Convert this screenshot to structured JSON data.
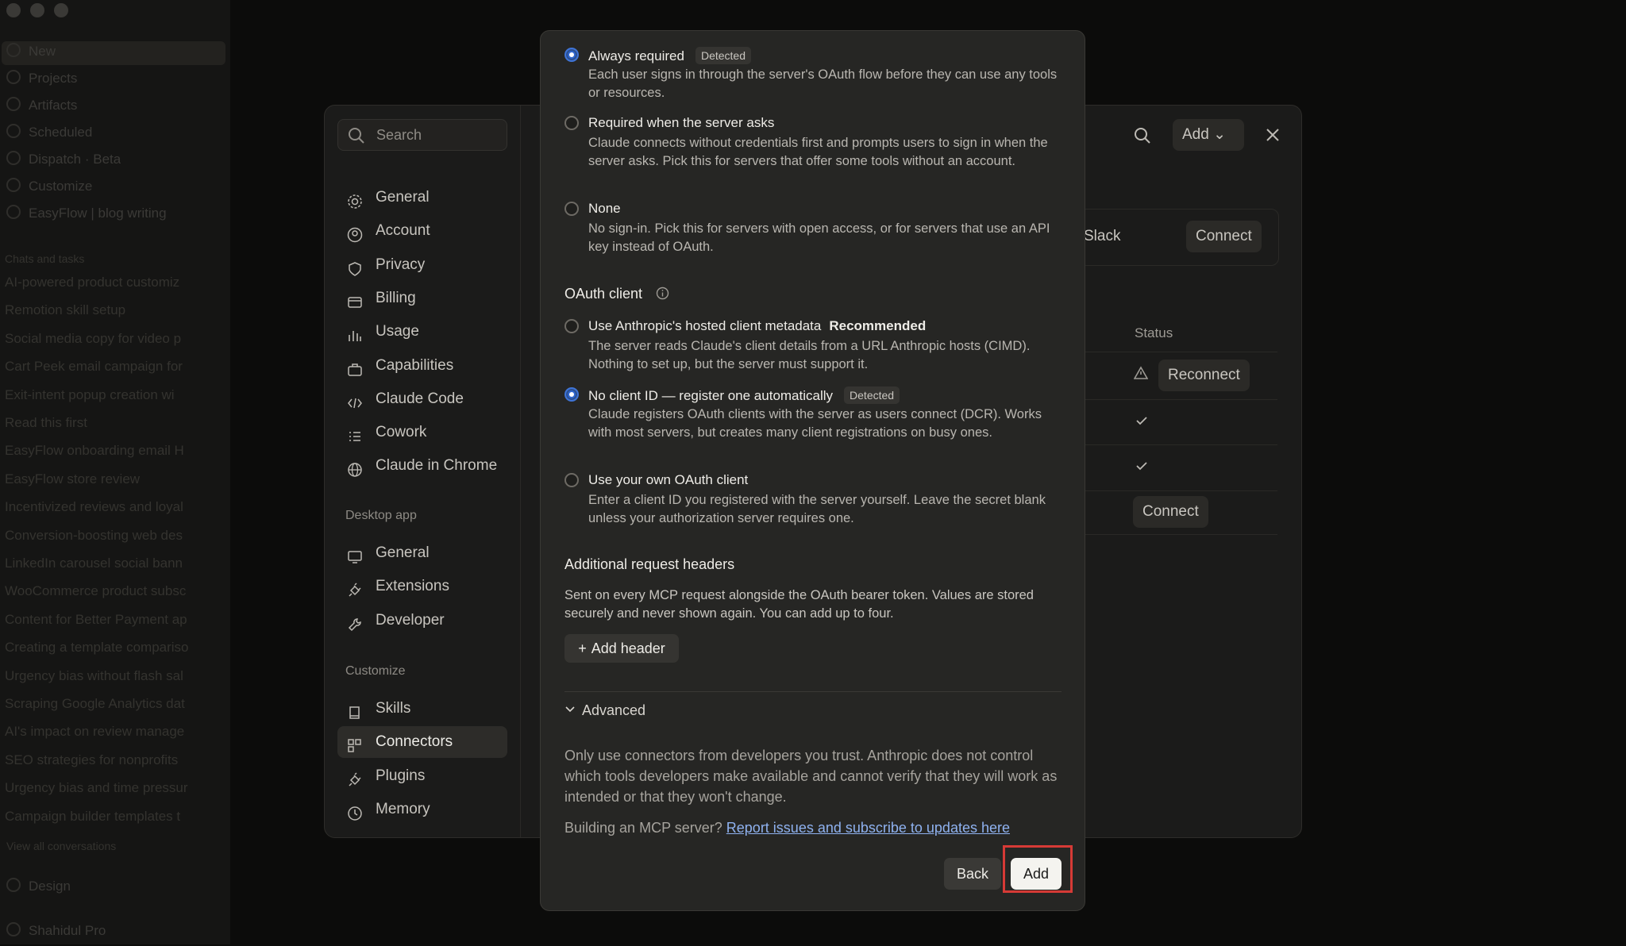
{
  "background_sidebar": {
    "rows": [
      "New",
      "Projects",
      "Artifacts",
      "Scheduled",
      "Dispatch · Beta",
      "Customize",
      "EasyFlow | blog writing"
    ],
    "section_label": "Chats and tasks",
    "chats": [
      "AI-powered product customiz",
      "Remotion skill setup",
      "Social media copy for video p",
      "Cart Peek email campaign for",
      "Exit-intent popup creation wi",
      "Read this first",
      "EasyFlow onboarding email H",
      "EasyFlow store review",
      "Incentivized reviews and loyal",
      "Conversion-boosting web des",
      "LinkedIn carousel social bann",
      "WooCommerce product subsc",
      "Content for Better Payment ap",
      "Creating a template compariso",
      "Urgency bias without flash sal",
      "Scraping Google Analytics dat",
      "AI's impact on review manage",
      "SEO strategies for nonprofits",
      "Urgency bias and time pressur",
      "Campaign builder templates t"
    ],
    "view_all": "View all conversations",
    "design": "Design",
    "user": "Shahidul",
    "plan": "Pro"
  },
  "settings": {
    "search_placeholder": "Search",
    "nav": [
      "General",
      "Account",
      "Privacy",
      "Billing",
      "Usage",
      "Capabilities",
      "Claude Code",
      "Cowork",
      "Claude in Chrome"
    ],
    "desktop_section": "Desktop app",
    "desktop_nav": [
      "General",
      "Extensions",
      "Developer"
    ],
    "customize_section": "Customize",
    "customize_nav": [
      "Skills",
      "Connectors",
      "Plugins",
      "Memory"
    ],
    "top_add": "Add",
    "slack_label": "Slack",
    "slack_connect": "Connect",
    "status_header": "Status",
    "reconnect": "Reconnect",
    "connect": "Connect"
  },
  "modal": {
    "auth_options": [
      {
        "title": "Always required",
        "badge": "Detected",
        "desc": "Each user signs in through the server's OAuth flow before they can use any tools or resources.",
        "checked": true
      },
      {
        "title": "Required when the server asks",
        "badge": "",
        "desc": "Claude connects without credentials first and prompts users to sign in when the server asks. Pick this for servers that offer some tools without an account.",
        "checked": false
      },
      {
        "title": "None",
        "badge": "",
        "desc": "No sign-in. Pick this for servers with open access, or for servers that use an API key instead of OAuth.",
        "checked": false
      }
    ],
    "oauth_client_heading": "OAuth client",
    "client_options": [
      {
        "title": "Use Anthropic's hosted client metadata",
        "tag": "Recommended",
        "desc": "The server reads Claude's client details from a URL Anthropic hosts (CIMD). Nothing to set up, but the server must support it.",
        "checked": false
      },
      {
        "title": "No client ID — register one automatically",
        "badge": "Detected",
        "desc": "Claude registers OAuth clients with the server as users connect (DCR). Works with most servers, but creates many client registrations on busy ones.",
        "checked": true
      },
      {
        "title": "Use your own OAuth client",
        "desc": "Enter a client ID you registered with the server yourself. Leave the secret blank unless your authorization server requires one.",
        "checked": false
      }
    ],
    "headers_heading": "Additional request headers",
    "headers_desc": "Sent on every MCP request alongside the OAuth bearer token. Values are stored securely and never shown again. You can add up to four.",
    "add_header_label": "Add header",
    "advanced_label": "Advanced",
    "trust_notice": "Only use connectors from developers you trust. Anthropic does not control which tools developers make available and cannot verify that they will work as intended or that they won't change.",
    "building_prefix": "Building an MCP server?",
    "building_link": "Report issues and subscribe to updates here",
    "back_label": "Back",
    "add_label": "Add",
    "highlight_color": "#d63a36",
    "accent_color": "#2f66cf"
  }
}
